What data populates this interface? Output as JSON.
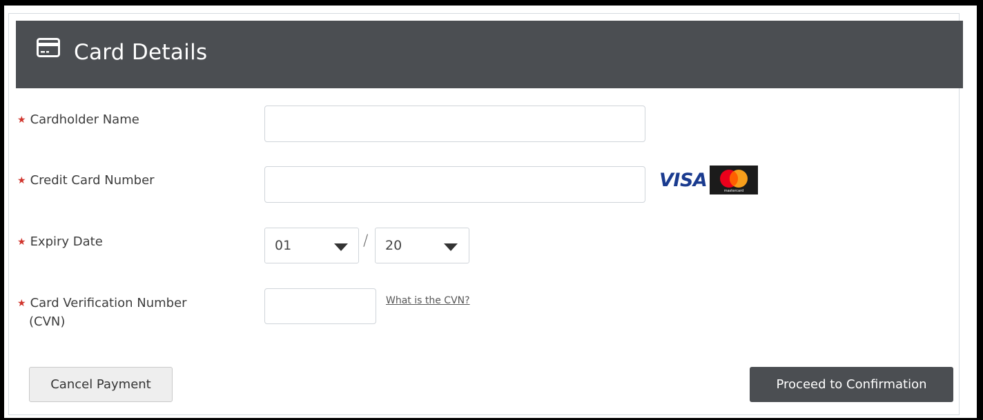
{
  "header": {
    "title": "Card Details",
    "icon": "credit-card-icon"
  },
  "fields": {
    "cardholder_name": {
      "label": "Cardholder Name",
      "value": ""
    },
    "card_number": {
      "label": "Credit Card Number",
      "value": ""
    },
    "expiry": {
      "label": "Expiry Date",
      "month": "01",
      "separator": "/",
      "year": "20"
    },
    "cvn": {
      "label_line1": "Card Verification Number",
      "label_line2": "(CVN)",
      "value": "",
      "help_link": "What is the CVN?"
    }
  },
  "required_marker": "★",
  "card_brands": {
    "visa": "VISA",
    "mastercard": "mastercard"
  },
  "buttons": {
    "cancel": "Cancel Payment",
    "proceed": "Proceed to Confirmation"
  },
  "colors": {
    "header_bg": "#4b4e52",
    "required": "#d0342c",
    "visa_blue": "#1a3b8f",
    "mc_red": "#eb001b",
    "mc_orange": "#f79e1b"
  }
}
